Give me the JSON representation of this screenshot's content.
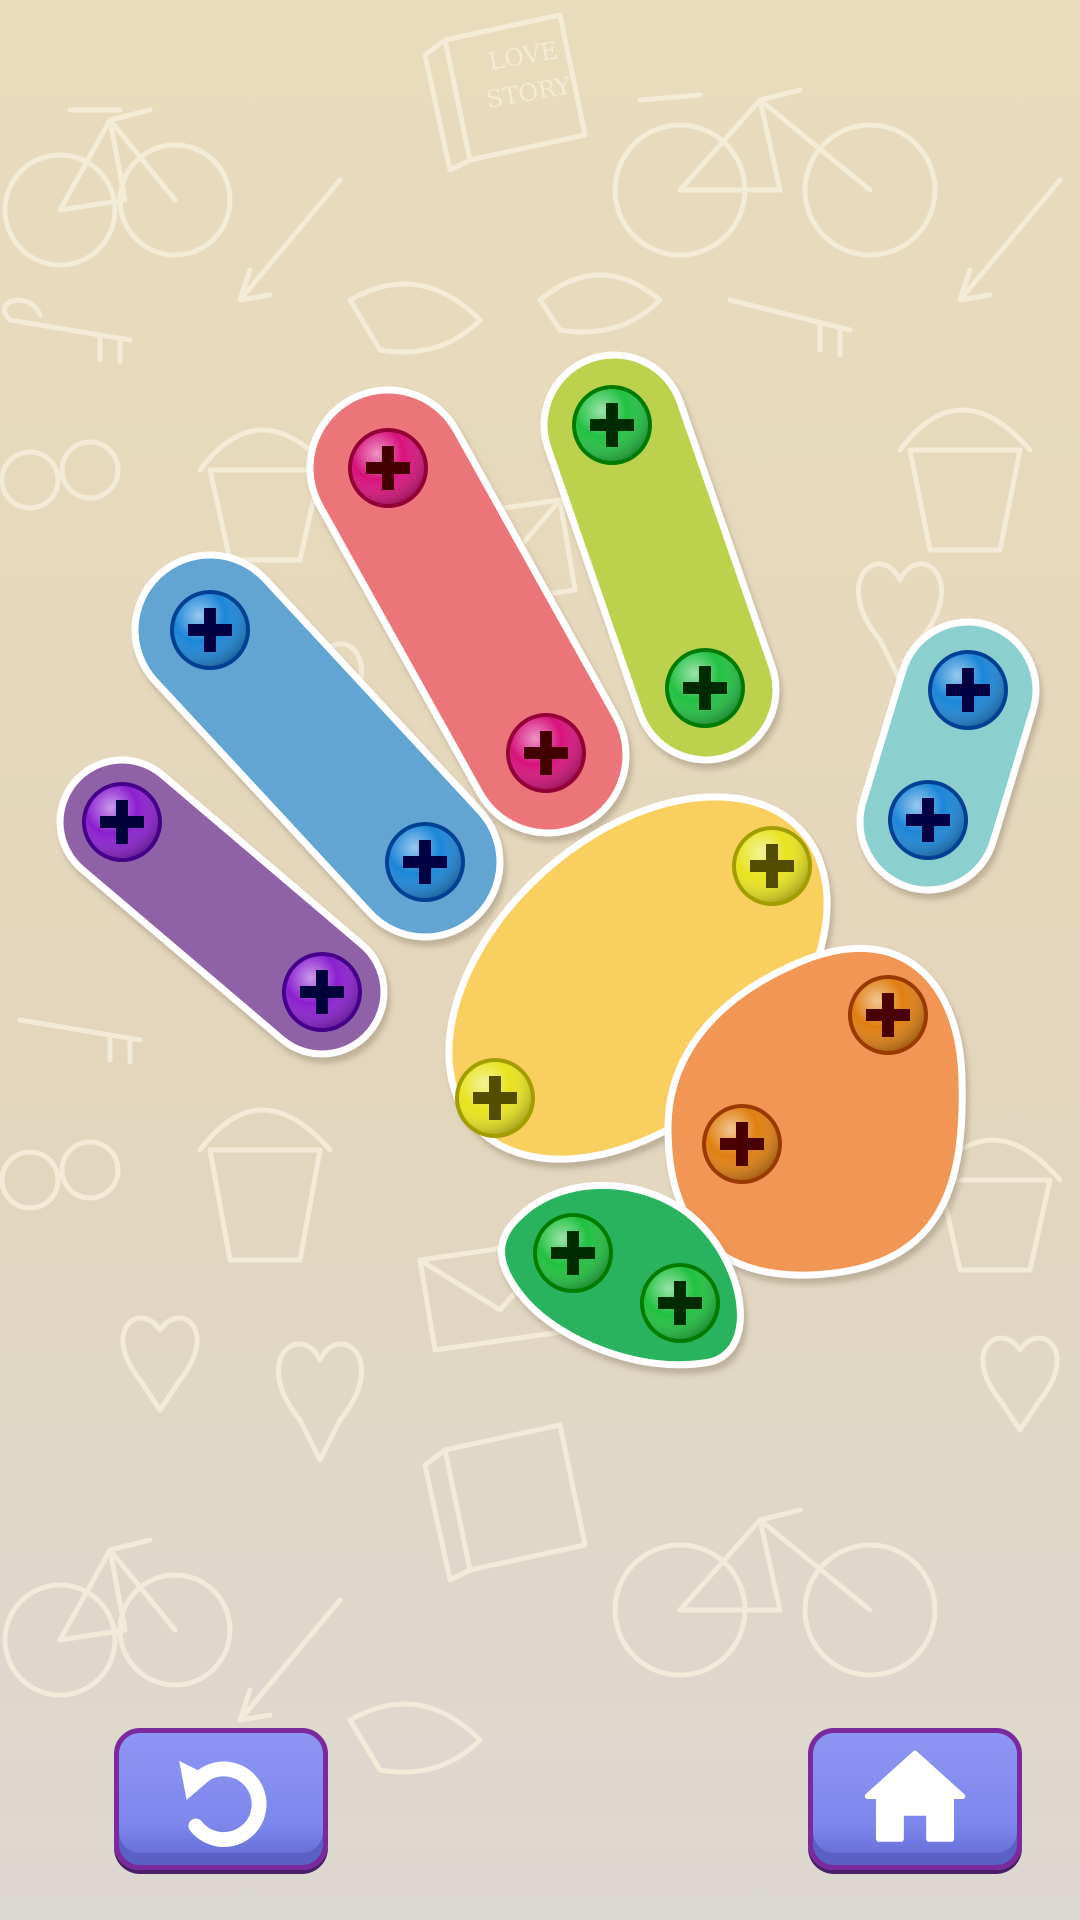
{
  "background": {
    "color_top": "#e9dcbd",
    "color_bottom": "#dcd8d2",
    "doodle_color": "#f6efdc",
    "book_text_line1": "LOVE",
    "book_text_line2": "STORY"
  },
  "pieces": [
    {
      "name": "piece-purple",
      "color": "#8f62a8",
      "screw_color": "#8b1fd0",
      "screws": 2
    },
    {
      "name": "piece-blue",
      "color": "#62a4d2",
      "screw_color": "#1b86d8",
      "screws": 2
    },
    {
      "name": "piece-red",
      "color": "#ec7579",
      "screw_color": "#d8127c",
      "screws": 2
    },
    {
      "name": "piece-lime",
      "color": "#bcd24e",
      "screw_color": "#22c142",
      "screws": 2
    },
    {
      "name": "piece-teal",
      "color": "#8bcfcf",
      "screw_color": "#1b86d8",
      "screws": 2
    },
    {
      "name": "piece-yellow",
      "color": "#f9cf60",
      "screw_color": "#e8e31e",
      "screws": 2
    },
    {
      "name": "piece-orange",
      "color": "#f19654",
      "screw_color": "#e07f10",
      "screws": 2
    },
    {
      "name": "piece-green",
      "color": "#2bb35e",
      "screw_color": "#20c140",
      "screws": 2
    }
  ],
  "buttons": {
    "undo_icon": "undo-icon",
    "home_icon": "home-icon",
    "button_color": "#7f87ee",
    "button_border": "#7a2a9c"
  }
}
